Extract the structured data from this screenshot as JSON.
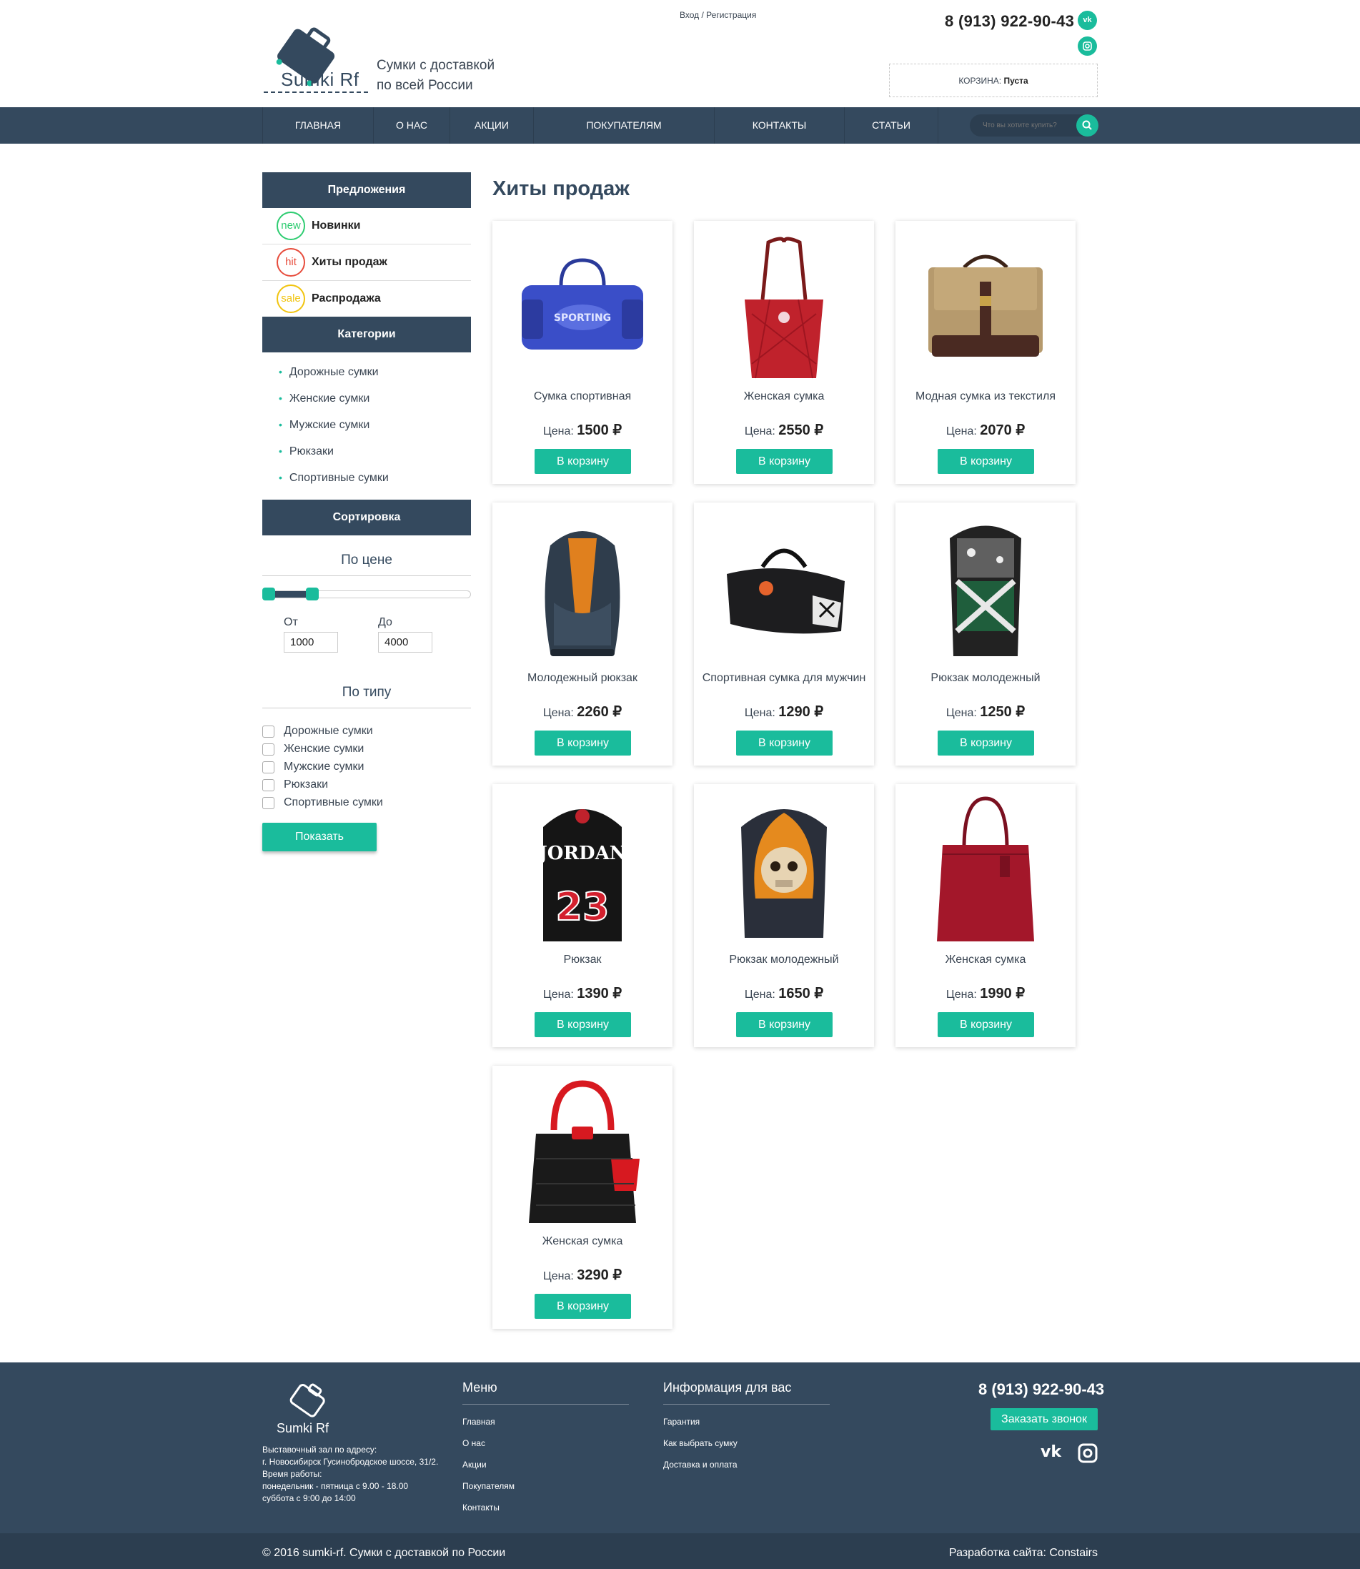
{
  "header": {
    "logo_text": "Sumki Rf",
    "tagline_line1": "Сумки с доставкой",
    "tagline_line2": "по всей России",
    "login": "Вход",
    "sep": " / ",
    "register": "Регистрация",
    "phone": "8 (913) 922-90-43",
    "cart_label": "КОРЗИНА: ",
    "cart_status": "Пуста",
    "social": [
      "vk-icon",
      "instagram-icon"
    ]
  },
  "nav": {
    "items": [
      "ГЛАВНАЯ",
      "О НАС",
      "АКЦИИ",
      "ПОКУПАТЕЛЯМ",
      "КОНТАКТЫ",
      "СТАТЬИ"
    ],
    "search_placeholder": "Что вы хотите купить?"
  },
  "sidebar": {
    "offers_title": "Предложения",
    "offers": [
      {
        "badge": "new",
        "label": "Новинки",
        "color": "#2ecc71"
      },
      {
        "badge": "hit",
        "label": "Хиты продаж",
        "color": "#e74c3c"
      },
      {
        "badge": "sale",
        "label": "Распродажа",
        "color": "#f1c40f"
      }
    ],
    "categories_title": "Категории",
    "categories": [
      "Дорожные сумки",
      "Женские сумки",
      "Мужские сумки",
      "Рюкзаки",
      "Спортивные сумки"
    ],
    "sort_title": "Сортировка",
    "price_title": "По цене",
    "from_label": "От",
    "to_label": "До",
    "from_value": "1000",
    "to_value": "4000",
    "type_title": "По типу",
    "types": [
      "Дорожные сумки",
      "Женские сумки",
      "Мужские сумки",
      "Рюкзаки",
      "Спортивные сумки"
    ],
    "show_button": "Показать"
  },
  "main": {
    "title": "Хиты продаж",
    "price_label": "Цена: ",
    "buy_label": "В корзину",
    "products": [
      {
        "name": "Сумка спортивная",
        "price": "1500 ₽",
        "img": "blue-sport-bag"
      },
      {
        "name": "Женская сумка",
        "price": "2550 ₽",
        "img": "red-quilted-tote"
      },
      {
        "name": "Модная сумка из текстиля",
        "price": "2070 ₽",
        "img": "beige-canvas-messenger"
      },
      {
        "name": "Молодежный рюкзак",
        "price": "2260 ₽",
        "img": "grey-orange-backpack"
      },
      {
        "name": "Спортивная сумка для мужчин",
        "price": "1290 ₽",
        "img": "black-duffel-bag"
      },
      {
        "name": "Рюкзак молодежный",
        "price": "1250 ₽",
        "img": "flag-print-backpack"
      },
      {
        "name": "Рюкзак",
        "price": "1390 ₽",
        "img": "jordan-23-backpack"
      },
      {
        "name": "Рюкзак молодежный",
        "price": "1650 ₽",
        "img": "skull-fire-backpack"
      },
      {
        "name": "Женская сумка",
        "price": "1990 ₽",
        "img": "burgundy-leather-bag"
      },
      {
        "name": "Женская сумка",
        "price": "3290 ₽",
        "img": "black-red-handbag"
      }
    ]
  },
  "footer": {
    "logo_text": "Sumki Rf",
    "address_lines": [
      "Выставочный зал по адресу:",
      "г. Новосибирск Гусинобродское шоссе, 31/2.",
      "Время работы:",
      "понедельник - пятница с 9.00 - 18.00",
      "суббота с 9:00 до 14:00"
    ],
    "menu_title": "Меню",
    "menu": [
      "Главная",
      "О нас",
      "Акции",
      "Покупателям",
      "Контакты"
    ],
    "info_title": "Информация для вас",
    "info": [
      "Гарантия",
      "Как выбрать сумку",
      "Доставка и оплата"
    ],
    "phone": "8 (913) 922-90-43",
    "callback": "Заказать звонок",
    "copyright": "© 2016 sumki-rf. Сумки с доставкой по России",
    "developer": "Разработка сайта: Constairs"
  },
  "colors": {
    "accent": "#1abc9c",
    "dark": "#34495e",
    "darker": "#2c3e50"
  }
}
